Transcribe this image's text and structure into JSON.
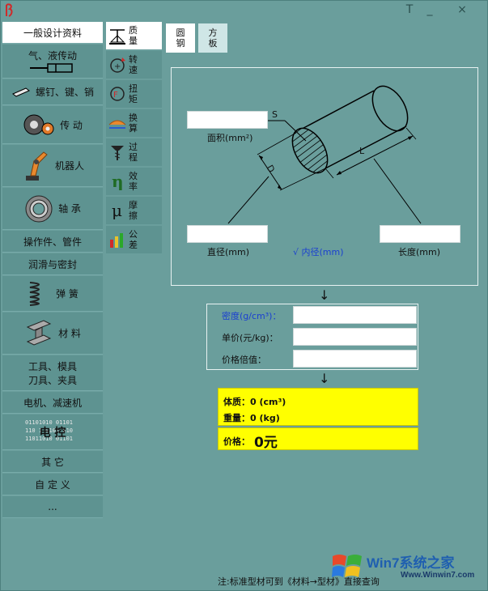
{
  "window": {
    "minimize_glyph": "_",
    "close_glyph": "×",
    "t_glyph": "T"
  },
  "sidebar": {
    "items": [
      {
        "label": "一般设计资料",
        "icon": ""
      },
      {
        "label": "气、液传动",
        "icon": "cylinder-icon"
      },
      {
        "label": "螺钉、键、销",
        "icon": "key-icon"
      },
      {
        "label": "传 动",
        "icon": "gear-icon"
      },
      {
        "label": "机器人",
        "icon": "robot-arm-icon"
      },
      {
        "label": "轴 承",
        "icon": "bearing-icon"
      },
      {
        "label": "操作件、管件",
        "icon": ""
      },
      {
        "label": "润滑与密封",
        "icon": ""
      },
      {
        "label": "弹 簧",
        "icon": "spring-icon"
      },
      {
        "label": "材 料",
        "icon": "ibeam-icon"
      },
      {
        "label": "工具、模具",
        "label2": "刀具、夹具",
        "icon": ""
      },
      {
        "label": "电机、减速机",
        "icon": ""
      },
      {
        "label": "电 控",
        "icon": "binary-icon",
        "binary": [
          "01101010 01101",
          "110 1 0101 010",
          "11011010 01101"
        ]
      },
      {
        "label": "其 它",
        "icon": ""
      },
      {
        "label": "自 定 义",
        "icon": ""
      },
      {
        "label": "...",
        "icon": ""
      }
    ]
  },
  "tools": {
    "items": [
      {
        "label": "质量",
        "icon": "scale-icon"
      },
      {
        "label": "转速",
        "icon": "rotation-icon"
      },
      {
        "label": "扭矩",
        "icon": "torque-icon"
      },
      {
        "label": "换算",
        "icon": "convert-icon"
      },
      {
        "label": "过程",
        "icon": "drill-icon"
      },
      {
        "label": "效率",
        "icon": "eta-icon"
      },
      {
        "label": "摩擦",
        "icon": "mu-icon"
      },
      {
        "label": "公差",
        "icon": "tolerance-icon"
      }
    ]
  },
  "tabs": [
    {
      "label": "圆钢"
    },
    {
      "label": "方板"
    }
  ],
  "diagram": {
    "area_label": "面积(mm²)",
    "diameter_label": "直径(mm)",
    "inner_diameter_label": "√ 内径(mm)",
    "length_label": "长度(mm)",
    "s_mark": "S",
    "d_mark": "D",
    "l_mark": "L",
    "area_value": "",
    "diameter_value": "",
    "length_value": ""
  },
  "arrows": {
    "down": "↓"
  },
  "form": {
    "density_label": "密度(g/cm³)：",
    "price_label": "单价(元/kg)：",
    "multiplier_label": "价格倍值：",
    "density_value": "",
    "price_value": "",
    "multiplier_value": ""
  },
  "result": {
    "volume_text": "体质：0 (cm³)",
    "weight_text": "重量：0 (kg)",
    "price_label": "价格：",
    "price_value": "0元"
  },
  "footer": {
    "note": "注:标准型材可到《材料→型材》直接查询"
  },
  "watermark": {
    "brand": "Win7系统之家",
    "url": "Www.Winwin7.com"
  },
  "colors": {
    "background": "#6a9e9c",
    "item": "#5e9391",
    "active": "#ffffff",
    "result_yellow": "#ffff00",
    "link_blue": "#1a3fd1"
  }
}
